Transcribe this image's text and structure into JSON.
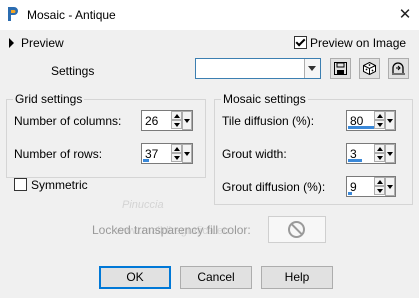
{
  "window": {
    "title": "Mosaic - Antique",
    "close_glyph": "✕"
  },
  "top": {
    "preview_label": "Preview",
    "preview_on_image_label": "Preview on Image",
    "preview_on_image_checked": true,
    "settings_label": "Settings",
    "settings_value": ""
  },
  "icons": [
    "app-icon",
    "save-icon",
    "randomize-icon",
    "reset-icon",
    "no-color-icon"
  ],
  "grid": {
    "title": "Grid settings",
    "columns_label": "Number of columns:",
    "columns_value": "26",
    "rows_label": "Number of rows:",
    "rows_value": "37",
    "symmetric_label": "Symmetric",
    "symmetric_checked": false
  },
  "mosaic": {
    "title": "Mosaic settings",
    "tile_diffusion_label": "Tile diffusion (%):",
    "tile_diffusion_value": "80",
    "grout_width_label": "Grout width:",
    "grout_width_value": "3",
    "grout_diffusion_label": "Grout diffusion (%):",
    "grout_diffusion_value": "9"
  },
  "fill": {
    "label": "Locked transparency fill color:"
  },
  "watermark": {
    "text": "Pinuccia",
    "url": "www.maildiregrafica.eu"
  },
  "buttons": {
    "ok": "OK",
    "cancel": "Cancel",
    "help": "Help"
  }
}
